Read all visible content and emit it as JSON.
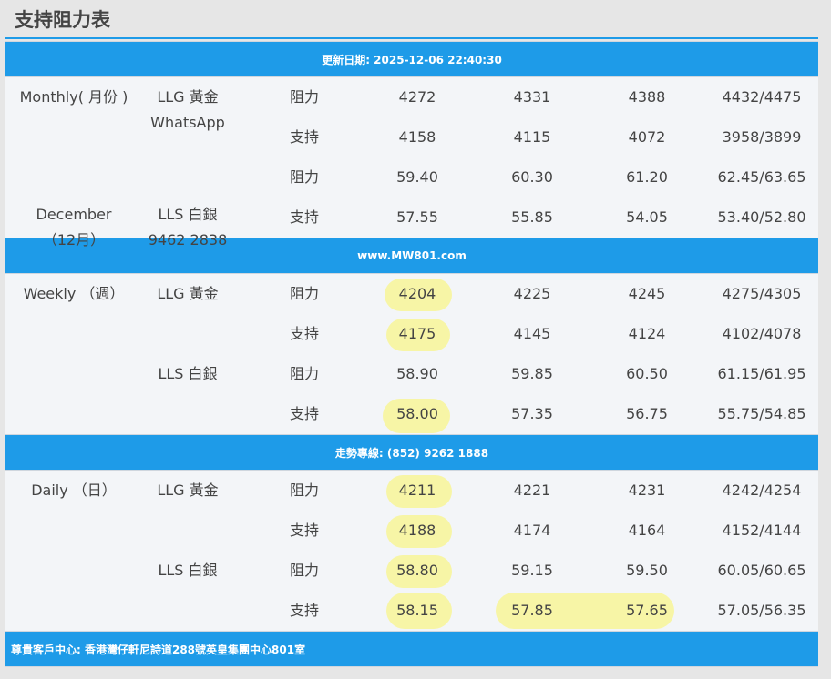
{
  "page_title": "支持阻力表",
  "bands": {
    "update": "更新日期: 2025-12-06 22:40:30",
    "website": "www.MW801.com",
    "hotline": "走勢專線: (852) 9262 1888",
    "address": "尊貴客戶中心: 香港灣仔軒尼詩道288號英皇集團中心801室"
  },
  "monthly": {
    "period_line1": "Monthly( 月份 )",
    "period_line2": "December",
    "period_line3": "（12月）",
    "gold_name": "LLG 黃金",
    "gold_sub": "WhatsApp",
    "silver_name": "LLS 白銀",
    "silver_sub": "9462 2838",
    "rows": [
      {
        "label": "阻力",
        "v": [
          "4272",
          "4331",
          "4388",
          "4432/4475"
        ]
      },
      {
        "label": "支持",
        "v": [
          "4158",
          "4115",
          "4072",
          "3958/3899"
        ]
      },
      {
        "label": "阻力",
        "v": [
          "59.40",
          "60.30",
          "61.20",
          "62.45/63.65"
        ]
      },
      {
        "label": "支持",
        "v": [
          "57.55",
          "55.85",
          "54.05",
          "53.40/52.80"
        ]
      }
    ]
  },
  "weekly": {
    "period": "Weekly （週）",
    "gold_name": "LLG 黃金",
    "silver_name": "LLS 白銀",
    "rows": [
      {
        "label": "阻力",
        "v": [
          "4204",
          "4225",
          "4245",
          "4275/4305"
        ]
      },
      {
        "label": "支持",
        "v": [
          "4175",
          "4145",
          "4124",
          "4102/4078"
        ]
      },
      {
        "label": "阻力",
        "v": [
          "58.90",
          "59.85",
          "60.50",
          "61.15/61.95"
        ]
      },
      {
        "label": "支持",
        "v": [
          "58.00",
          "57.35",
          "56.75",
          "55.75/54.85"
        ]
      }
    ]
  },
  "daily": {
    "period": "Daily （日）",
    "gold_name": "LLG 黃金",
    "silver_name": "LLS 白銀",
    "rows": [
      {
        "label": "阻力",
        "v": [
          "4211",
          "4221",
          "4231",
          "4242/4254"
        ]
      },
      {
        "label": "支持",
        "v": [
          "4188",
          "4174",
          "4164",
          "4152/4144"
        ]
      },
      {
        "label": "阻力",
        "v": [
          "58.80",
          "59.15",
          "59.50",
          "60.05/60.65"
        ]
      },
      {
        "label": "支持",
        "v": [
          "58.15",
          "57.85",
          "57.65",
          "57.05/56.35"
        ]
      }
    ]
  },
  "colors": {
    "band": "#1e9be8",
    "highlight": "#f7f5a6",
    "row_bg": "#f3f5f8",
    "text": "#444444"
  }
}
